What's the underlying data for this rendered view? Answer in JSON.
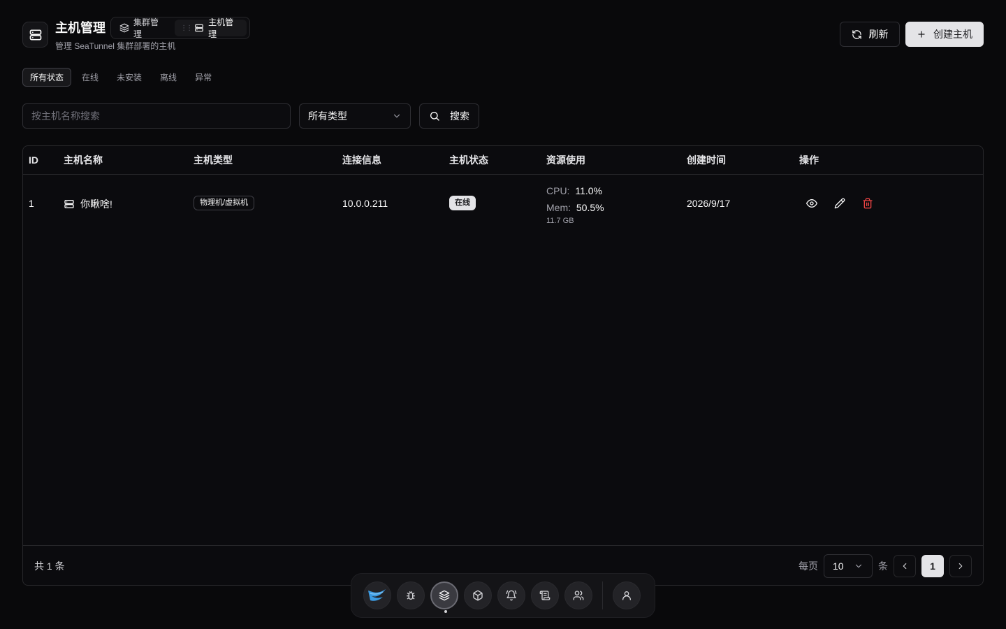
{
  "header": {
    "title": "主机管理",
    "subtitle": "管理 SeaTunnel 集群部署的主机",
    "nav": [
      {
        "label": "集群管理",
        "icon": "layers-icon"
      },
      {
        "label": "主机管理",
        "icon": "server-icon"
      }
    ],
    "refresh_label": "刷新",
    "create_label": "创建主机"
  },
  "status_tabs": [
    "所有状态",
    "在线",
    "未安装",
    "离线",
    "异常"
  ],
  "filters": {
    "search_placeholder": "按主机名称搜索",
    "type_select": "所有类型",
    "search_label": "搜索"
  },
  "table": {
    "columns": [
      "ID",
      "主机名称",
      "主机类型",
      "连接信息",
      "主机状态",
      "资源使用",
      "创建时间",
      "操作"
    ],
    "rows": [
      {
        "id": "1",
        "name": "你瞅啥!",
        "type": "物理机/虚拟机",
        "connection": "10.0.0.211",
        "status": "在线",
        "cpu_label": "CPU:",
        "cpu": "11.0%",
        "mem_label": "Mem:",
        "mem": "50.5%",
        "mem_total": "11.7 GB",
        "created": "2026/9/17"
      }
    ]
  },
  "footer": {
    "total": "共 1 条",
    "per_page_label": "每页",
    "per_page": "10",
    "unit": "条",
    "current_page": "1"
  },
  "colors": {
    "background": "#09090b",
    "primary_button": "#e4e4e7",
    "delete": "#ef4444"
  },
  "dock": {
    "items": [
      "seatunnel-logo-icon",
      "bug-icon",
      "layers-icon",
      "package-icon",
      "alarm-icon",
      "scroll-icon",
      "users-icon",
      "user-icon"
    ],
    "active": "layers-icon"
  }
}
